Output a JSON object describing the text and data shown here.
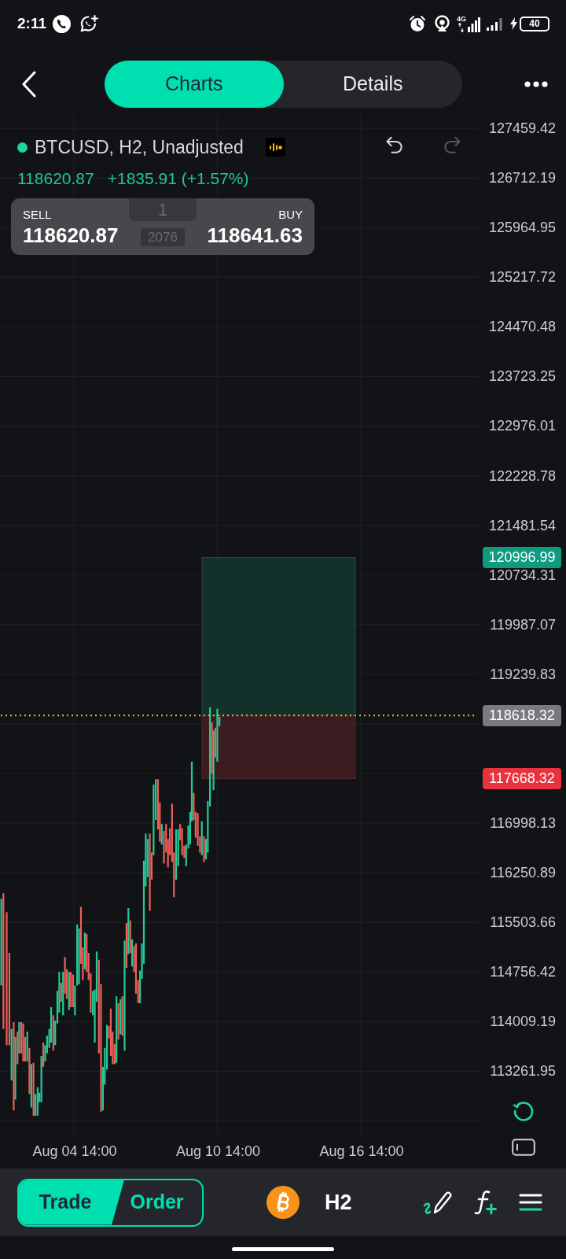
{
  "status_bar": {
    "time": "2:11",
    "network": "4G",
    "battery": "40"
  },
  "header": {
    "tabs": [
      {
        "label": "Charts",
        "selected": true
      },
      {
        "label": "Details",
        "selected": false
      }
    ]
  },
  "chart": {
    "symbol": "BTCUSD, H2, Unadjusted",
    "last_price": "118620.87",
    "change": "+1835.91 (+1.57%)",
    "history_buttons": [
      {
        "kind": "undo",
        "disabled": false
      },
      {
        "kind": "redo",
        "disabled": true
      }
    ],
    "quote": {
      "sell_label": "SELL",
      "sell_price": "118620.87",
      "quantity": "1",
      "spread": "2076",
      "buy_label": "BUY",
      "buy_price": "118641.63"
    },
    "price_axis": [
      "127459.42",
      "126712.19",
      "125964.95",
      "125217.72",
      "124470.48",
      "123723.25",
      "122976.01",
      "122228.78",
      "121481.54",
      "120734.31",
      "119987.07",
      "119239.83",
      "116998.13",
      "116250.89",
      "115503.66",
      "114756.42",
      "114009.19",
      "113261.95"
    ],
    "markers": [
      {
        "kind": "take_profit",
        "price": "120996.99"
      },
      {
        "kind": "current",
        "price": "118618.32"
      },
      {
        "kind": "stop_loss",
        "price": "117668.32"
      }
    ],
    "time_axis": [
      "Aug 04 14:00",
      "Aug 10 14:00",
      "Aug 16 14:00"
    ]
  },
  "bottom_bar": {
    "mode_toggle": [
      {
        "label": "Trade",
        "selected": true
      },
      {
        "label": "Order",
        "selected": false
      }
    ],
    "timeframe": "H2"
  }
}
